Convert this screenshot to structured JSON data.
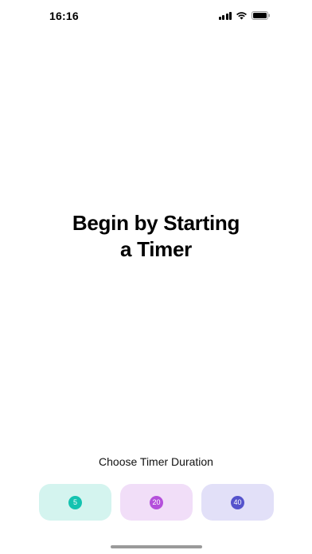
{
  "status_bar": {
    "time": "16:16",
    "icons": [
      "cellular-signal-icon",
      "wifi-icon",
      "battery-icon"
    ]
  },
  "headline": {
    "line1": "Begin by Starting",
    "line2": "a Timer"
  },
  "duration": {
    "label": "Choose Timer Duration",
    "options": [
      {
        "value": "5",
        "bg_color": "#d4f4ef",
        "badge_color": "#14c3b0"
      },
      {
        "value": "20",
        "bg_color": "#f1def8",
        "badge_color": "#b44fdb"
      },
      {
        "value": "40",
        "bg_color": "#e2e0f8",
        "badge_color": "#5553cc"
      }
    ]
  }
}
